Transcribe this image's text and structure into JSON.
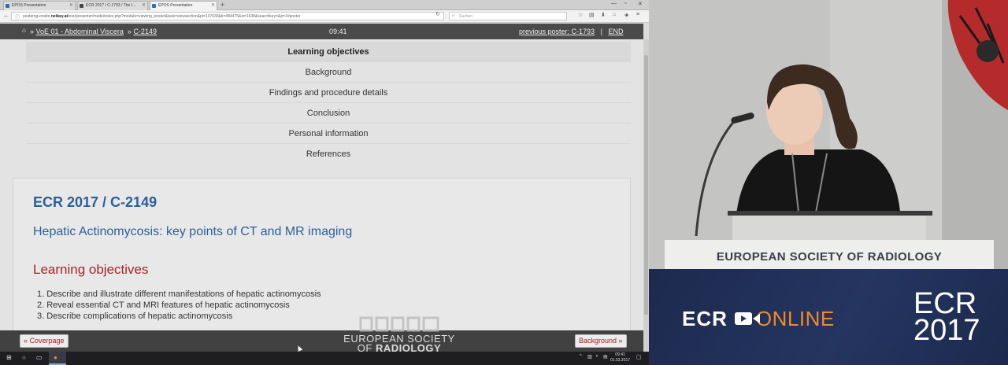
{
  "browser": {
    "tabs": [
      {
        "label": "EPOS Presentation"
      },
      {
        "label": "ECR 2017 / C-1793 / The I..."
      },
      {
        "label": "EPOS Presentation"
      }
    ],
    "url_prefix": "posterng-onsite.",
    "url_domain": "netkey.at",
    "url_rest": "/esr/presenter/mode/index.php?module=viewing_poster&task=viewsection&pi=137630&ti=484475&si=1638&searchkey=&p=1#poster",
    "search_placeholder": "Suchen"
  },
  "poster_bar": {
    "crumb_1": "VoE 01 - Abdominal Viscera",
    "crumb_2": "C-2149",
    "time": "09:41",
    "previous": "previous poster: C-1793",
    "separator": "|",
    "end": "END"
  },
  "toc": [
    {
      "label": "Learning objectives",
      "current": true
    },
    {
      "label": "Background"
    },
    {
      "label": "Findings and procedure details"
    },
    {
      "label": "Conclusion"
    },
    {
      "label": "Personal information"
    },
    {
      "label": "References"
    }
  ],
  "poster": {
    "id": "ECR 2017 / C-2149",
    "title": "Hepatic Actinomycosis: key points of CT and MR imaging",
    "section": "Learning objectives",
    "objectives": [
      "1. Describe and  illustrate different manifestations of hepatic actinomycosis",
      "2. Reveal essential CT and MRI features of hepatic actinomycosis",
      "3. Describe complications of hepatic actinomycosis"
    ]
  },
  "footer": {
    "prev_label": "« Coverpage",
    "next_label": "Background »",
    "esr_line1": "EUROPEAN SOCIETY",
    "esr_line2_pre": "OF ",
    "esr_line2_bold": "RADIOLOGY"
  },
  "taskbar": {
    "time": "09:41",
    "date": "01.03.2017"
  },
  "speaker_banner": "EUROPEAN SOCIETY OF RADIOLOGY",
  "brand": {
    "ecr": "ECR",
    "online": "ONLINE",
    "year_line1": "ECR",
    "year_line2": "2017"
  }
}
